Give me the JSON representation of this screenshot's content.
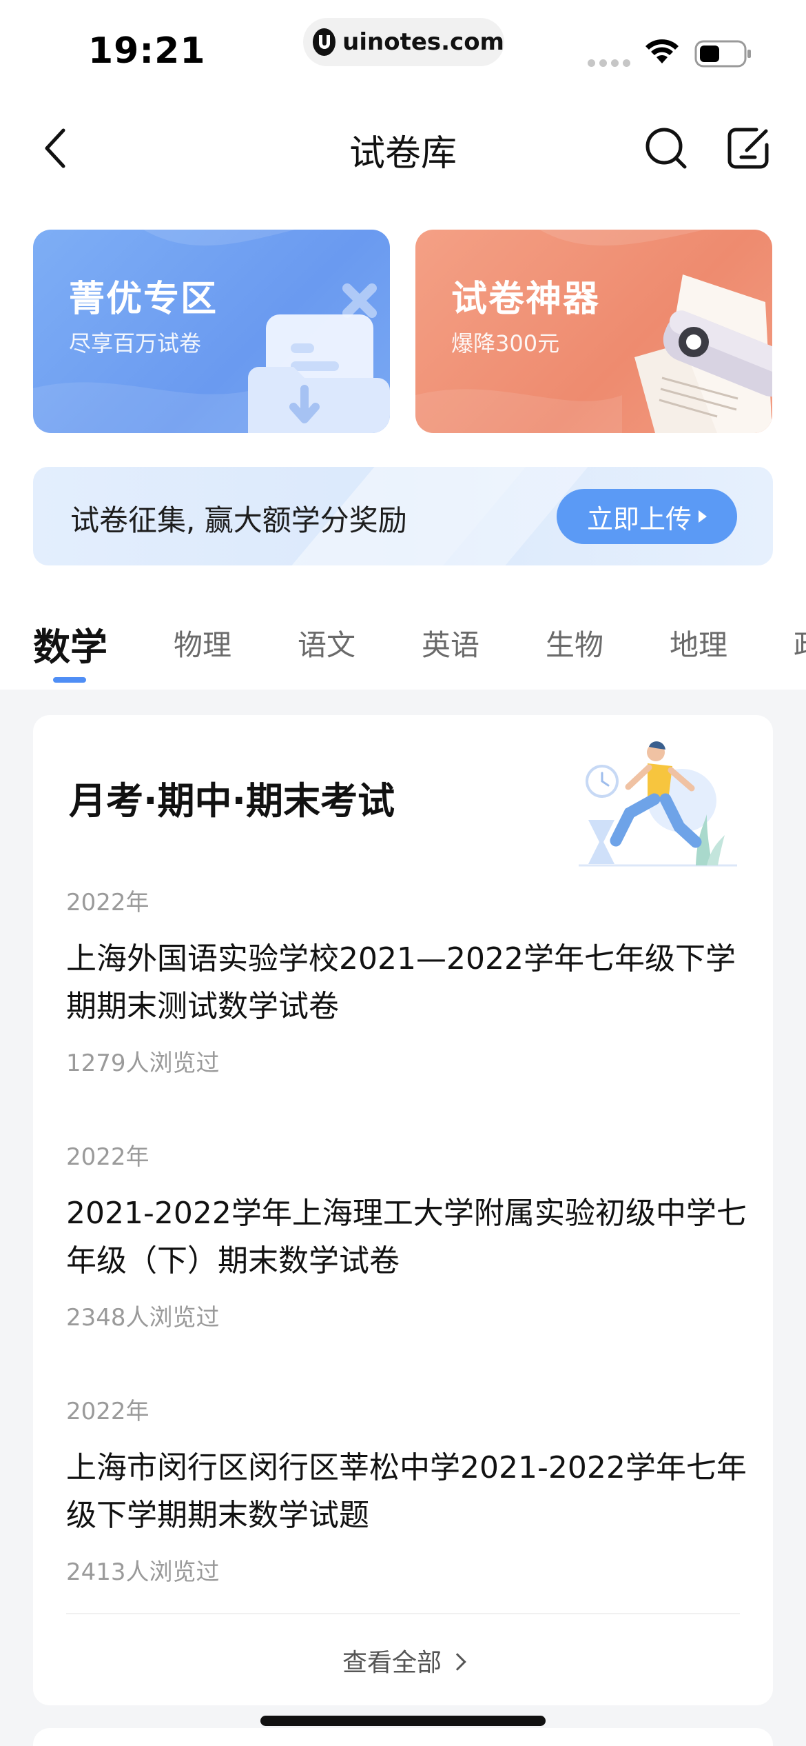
{
  "status_bar": {
    "time": "19:21",
    "url": "uinotes.com"
  },
  "nav": {
    "title": "试卷库",
    "back_icon": "chevron-left-icon",
    "search_icon": "search-icon",
    "edit_icon": "edit-icon"
  },
  "banners": [
    {
      "title": "菁优专区",
      "subtitle": "尽享百万试卷",
      "color": "#6f9ff2"
    },
    {
      "title": "试卷神器",
      "subtitle": "爆降300元",
      "color": "#f0906f"
    }
  ],
  "upload": {
    "text": "试卷征集, 赢大额学分奖励",
    "button_label": "立即上传"
  },
  "tabs": {
    "items": [
      "数学",
      "物理",
      "语文",
      "英语",
      "生物",
      "地理",
      "政"
    ],
    "active_index": 0,
    "accent_color": "#4f8ef5"
  },
  "card": {
    "title": "月考·期中·期末考试",
    "exams": [
      {
        "year": "2022年",
        "title": "上海外国语实验学校2021—2022学年七年级下学期期末测试数学试卷",
        "views": "1279人浏览过"
      },
      {
        "year": "2022年",
        "title": "2021-2022学年上海理工大学附属实验初级中学七年级（下）期末数学试卷",
        "views": "2348人浏览过"
      },
      {
        "year": "2022年",
        "title": "上海市闵行区闵行区莘松中学2021-2022学年七年级下学期期末数学试题",
        "views": "2413人浏览过"
      }
    ],
    "view_all_label": "查看全部"
  }
}
